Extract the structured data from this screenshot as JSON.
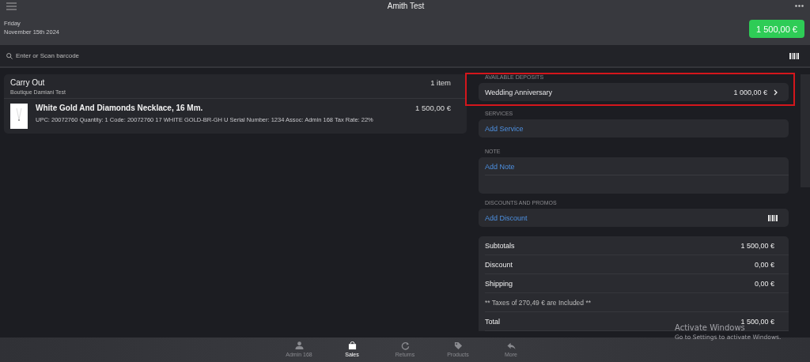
{
  "header": {
    "title": "Amith Test",
    "day": "Friday",
    "date": "November 15th 2024",
    "total_button": "1 500,00 €"
  },
  "search": {
    "placeholder": "Enter or Scan barcode"
  },
  "order": {
    "title": "Carry Out",
    "store": "Boutique Damiani Test",
    "count": "1 item",
    "items": [
      {
        "name": "White Gold And Diamonds Necklace, 16 Mm.",
        "details": "UPC: 20072760 Quantity: 1 Code: 20072760 17 WHITE GOLD-BR-GH U Serial Number: 1234 Assoc: Admin 168 Tax Rate: 22%",
        "price": "1 500,00 €"
      }
    ]
  },
  "sections": [
    {
      "kind": "deposit",
      "label": "AVAILABLE DEPOSITS",
      "highlighted": true,
      "name": "Wedding Anniversary",
      "amount": "1 000,00 €"
    },
    {
      "kind": "action",
      "label": "SERVICES",
      "highlighted": false,
      "action": "Add Service"
    },
    {
      "kind": "note",
      "label": "NOTE",
      "highlighted": false,
      "action": "Add Note"
    },
    {
      "kind": "barcode-action",
      "label": "DISCOUNTS AND PROMOS",
      "highlighted": false,
      "action": "Add Discount"
    }
  ],
  "totals": [
    {
      "kind": "row",
      "label": "Subtotals",
      "value": "1 500,00 €"
    },
    {
      "kind": "row",
      "label": "Discount",
      "value": "0,00 €"
    },
    {
      "kind": "row",
      "label": "Shipping",
      "value": "0,00 €"
    },
    {
      "kind": "note",
      "label": "** Taxes of 270,49 € are Included **"
    },
    {
      "kind": "row",
      "label": "Total",
      "value": "1 500,00 €"
    }
  ],
  "tabs": [
    {
      "kind": "person",
      "label": "Admin 168",
      "selected": false
    },
    {
      "kind": "bag",
      "label": "Sales",
      "selected": true
    },
    {
      "kind": "refresh",
      "label": "Returns",
      "selected": false
    },
    {
      "kind": "tags",
      "label": "Products",
      "selected": false
    },
    {
      "kind": "reply",
      "label": "More",
      "selected": false
    }
  ],
  "os_notice": {
    "title": "Activate Windows",
    "text": "Go to Settings to activate Windows."
  }
}
